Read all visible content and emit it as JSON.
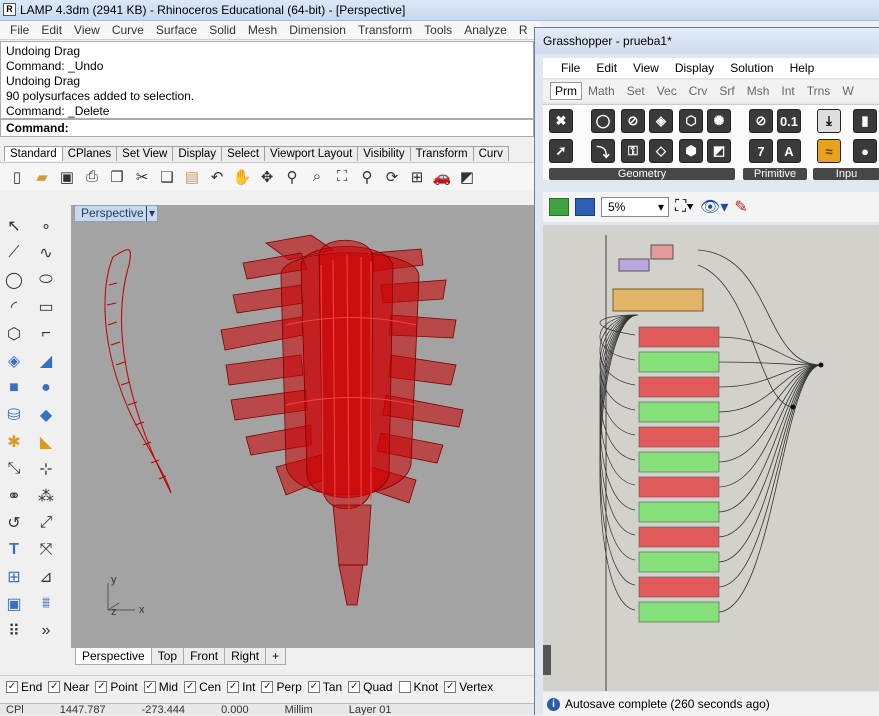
{
  "window": {
    "title": "LAMP 4.3dm (2941 KB) - Rhinoceros Educational (64-bit) - [Perspective]",
    "icon_label": "R"
  },
  "menu": [
    "File",
    "Edit",
    "View",
    "Curve",
    "Surface",
    "Solid",
    "Mesh",
    "Dimension",
    "Transform",
    "Tools",
    "Analyze",
    "R"
  ],
  "command_history": [
    "Undoing Drag",
    "Command: _Undo",
    "Undoing Drag",
    "90 polysurfaces added to selection.",
    "Command: _Delete"
  ],
  "command_prompt": "Command:",
  "toolbar_tabs": [
    "Standard",
    "CPlanes",
    "Set View",
    "Display",
    "Select",
    "Viewport Layout",
    "Visibility",
    "Transform",
    "Curv"
  ],
  "active_toolbar_tab": "Standard",
  "toolbar_icons": [
    "new-file-icon",
    "open-folder-icon",
    "save-icon",
    "print-icon",
    "import-icon",
    "cut-icon",
    "copy-icon",
    "paste-icon",
    "undo-icon",
    "pan-hand-icon",
    "rotate-view-icon",
    "zoom-icon",
    "zoom-window-icon",
    "zoom-extents-icon",
    "zoom-selected-icon",
    "rotate-camera-icon",
    "four-viewports-icon",
    "render-car-icon",
    "material-icon"
  ],
  "viewport": {
    "title": "Perspective",
    "axis_y": "y",
    "axis_z": "z",
    "axis_x": "x",
    "background": "#a3a3a3",
    "object_color": "#cc0000"
  },
  "viewport_tabs": [
    "Perspective",
    "Top",
    "Front",
    "Right",
    "+"
  ],
  "active_viewport_tab": "Perspective",
  "osnaps": [
    {
      "label": "End",
      "checked": true
    },
    {
      "label": "Near",
      "checked": true
    },
    {
      "label": "Point",
      "checked": true
    },
    {
      "label": "Mid",
      "checked": true
    },
    {
      "label": "Cen",
      "checked": true
    },
    {
      "label": "Int",
      "checked": true
    },
    {
      "label": "Perp",
      "checked": true
    },
    {
      "label": "Tan",
      "checked": true
    },
    {
      "label": "Quad",
      "checked": true
    },
    {
      "label": "Knot",
      "checked": false
    },
    {
      "label": "Vertex",
      "checked": true
    }
  ],
  "statusbar": [
    "CPl",
    "1447.787",
    "-273.444",
    "0.000",
    "Millim",
    "Layer 01"
  ],
  "grasshopper": {
    "title": "Grasshopper - prueba1*",
    "menu": [
      "File",
      "Edit",
      "View",
      "Display",
      "Solution",
      "Help"
    ],
    "tabs": [
      "Prm",
      "Math",
      "Set",
      "Vec",
      "Crv",
      "Srf",
      "Msh",
      "Int",
      "Trns",
      "W"
    ],
    "active_tab": "Prm",
    "groups": [
      "Geometry",
      "Primitive",
      "Inpu"
    ],
    "zoom": "5%",
    "status": "Autosave complete (260 seconds ago)",
    "node_colors": {
      "red": "#e25a5a",
      "green": "#86e07a",
      "orange": "#e3b56b",
      "pink": "#e69a9a"
    }
  }
}
